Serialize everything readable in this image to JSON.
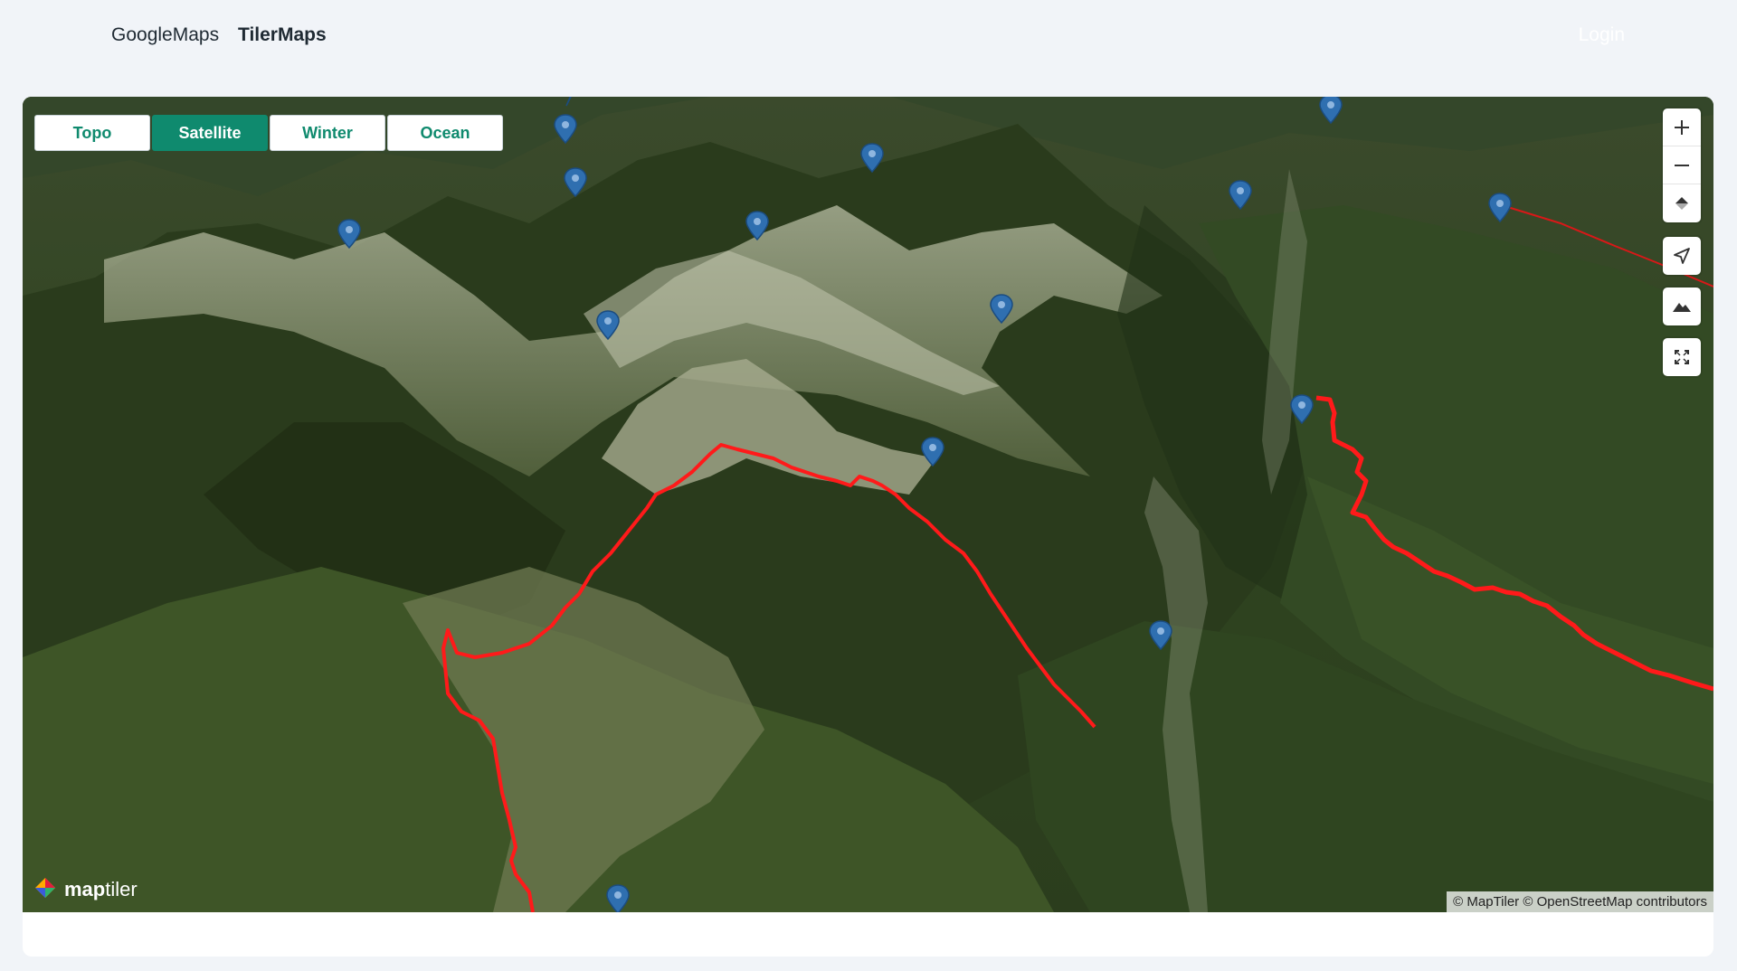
{
  "nav": {
    "links": [
      {
        "label": "GoogleMaps",
        "active": false
      },
      {
        "label": "TilerMaps",
        "active": true
      }
    ],
    "login_label": "Login"
  },
  "map": {
    "style_buttons": [
      {
        "label": "Topo",
        "active": false
      },
      {
        "label": "Satellite",
        "active": true
      },
      {
        "label": "Winter",
        "active": false
      },
      {
        "label": "Ocean",
        "active": false
      }
    ],
    "controls": {
      "zoom_in": "zoom-in-icon",
      "zoom_out": "zoom-out-icon",
      "compass": "compass-icon",
      "geolocate": "locate-arrow-icon",
      "terrain": "mountain-icon",
      "fullscreen": "fullscreen-icon"
    },
    "logo": {
      "bold": "map",
      "light": "tiler"
    },
    "attribution": "© MapTiler © OpenStreetMap contributors",
    "colors": {
      "route": "#ff1a1a",
      "marker": "#2f6fb0",
      "accent": "#0f8a6e"
    }
  }
}
